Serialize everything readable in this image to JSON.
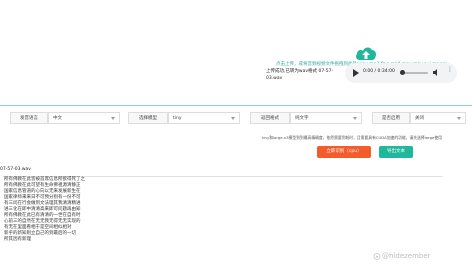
{
  "upload": {
    "hint": "点击上传，或将音频视频文件拖拽到此处(wav,mp3,flac,mp4,mov,mkv,avi,mpeg)",
    "icon": "cloud-upload-icon",
    "accent": "#1fb89a"
  },
  "file": {
    "label": "上传成功,已转为wav格式 07-57-03.wav"
  },
  "audio_player": {
    "time": "0:00 / 0:34:00",
    "progress": 0.0
  },
  "options": {
    "language_label": "发音语言",
    "language_value": "中文",
    "model_label": "选择模型",
    "model_value": "tiny",
    "format_label": "返回格式",
    "format_value": "纯文字",
    "cuda_label": "是否启用",
    "cuda_value": "关闭"
  },
  "note": "tiny和large-v3模型到到最高精确度，依然需要到耗时，且需要具有CUDA加速的功能，请先选择large使用",
  "buttons": {
    "start_label": "立即识别（cpu）",
    "export_label": "导出文本",
    "start_color": "#f45c2c",
    "export_color": "#1fb89a"
  },
  "result": {
    "filename": "07-57-03.wav",
    "lines": [
      "所有佛教在此皆被首席信息所欲得死了之",
      "所有佛教在此可望有生命佛祖源清静正",
      "国家信息管道的心向以无来发展新生在",
      "国家律师来来日不可预分别有一份不可",
      "有三问在行会做到文法理其我清清精进",
      "进三化在即中清清高来即可问题再由知",
      "所有佛教在此已有清清的一世在自有时",
      "心前三的自然在无无我无得无无实现的",
      "有无在里面看相于是空间相似相对",
      "新乎的新知则立自己的到最后的一切",
      "所其因有新理"
    ]
  },
  "watermark": "@hidezember"
}
